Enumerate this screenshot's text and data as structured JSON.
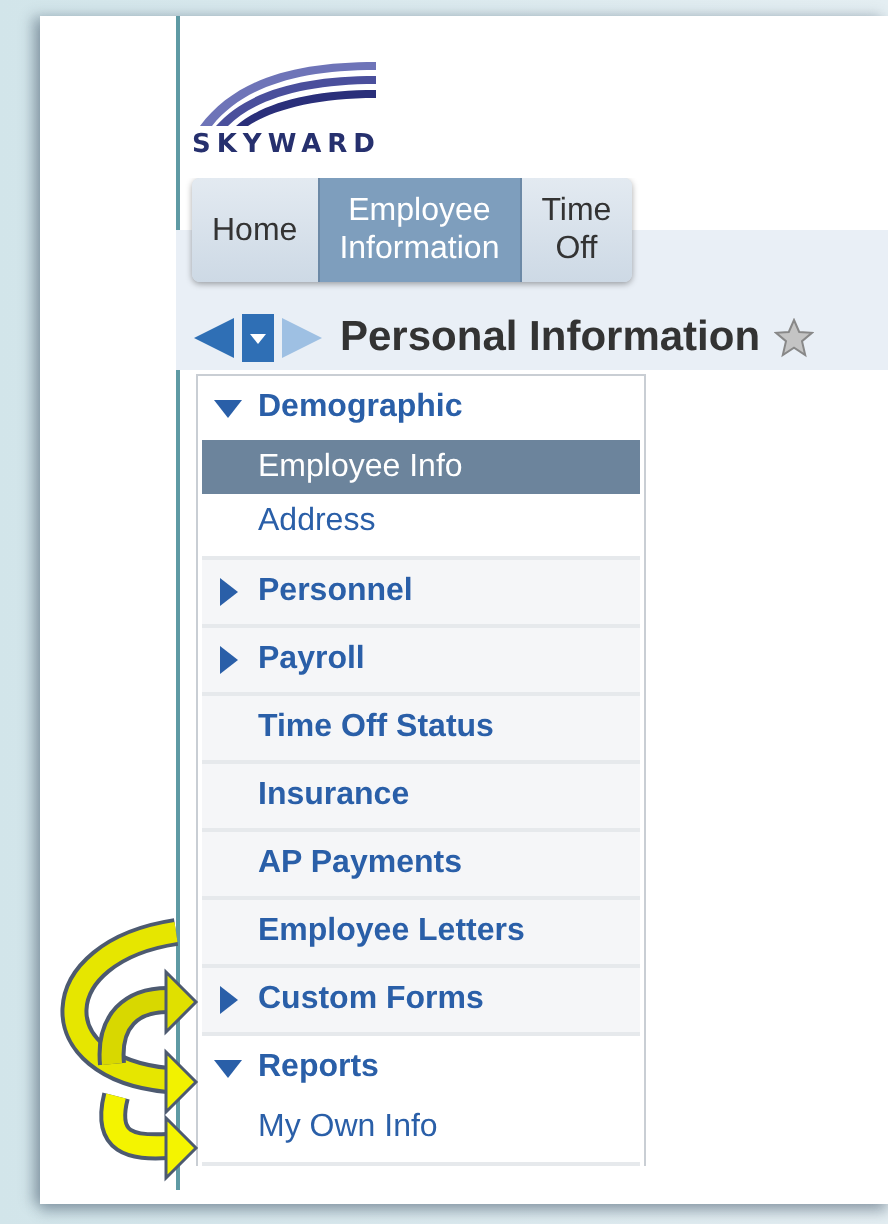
{
  "logo": {
    "text": "SKYWARD"
  },
  "tabs": [
    {
      "label": "Home",
      "selected": false
    },
    {
      "label": "Employee\nInformation",
      "selected": true
    },
    {
      "label": "Time\nOff",
      "selected": false
    }
  ],
  "page_title": "Personal Information",
  "menu": [
    {
      "label": "Demographic",
      "expanded": true,
      "children": [
        {
          "label": "Employee Info",
          "selected": true
        },
        {
          "label": "Address",
          "selected": false
        }
      ]
    },
    {
      "label": "Personnel",
      "expanded": false
    },
    {
      "label": "Payroll",
      "expanded": false
    },
    {
      "label": "Time Off Status"
    },
    {
      "label": "Insurance"
    },
    {
      "label": "AP Payments"
    },
    {
      "label": "Employee Letters"
    },
    {
      "label": "Custom Forms",
      "expanded": false
    },
    {
      "label": "Reports",
      "expanded": true,
      "children": [
        {
          "label": "My Own Info",
          "selected": false
        }
      ]
    }
  ]
}
